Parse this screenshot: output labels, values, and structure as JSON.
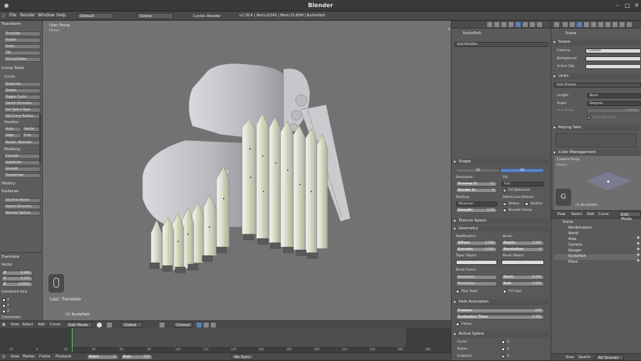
{
  "titlebar": {
    "title": "Blender"
  },
  "menubar": {
    "items": [
      "File",
      "Render",
      "Window",
      "Help"
    ],
    "screen_layout": "Default",
    "scene": "Scene",
    "engine": "Cycles Render",
    "info": "v2.78.4 | Verts:0/245 | Mem:15.80M | NurbsPath"
  },
  "toolshelf": {
    "transform_header": "Transform",
    "transform_buttons": [
      "Translate",
      "Rotate",
      "Scale",
      "Tilt",
      "Shrink/Fatten"
    ],
    "curve_tools_header": "Curve Tools",
    "curve_label": "Curve:",
    "curve_buttons": [
      "Duplicate",
      "Delete",
      "Toggle Cyclic",
      "Switch Direction",
      "Set Spline Type",
      "Set Curve Radius"
    ],
    "handles_label": "Handles:",
    "handle_buttons": [
      "Auto",
      "Vector",
      "Align",
      "Free"
    ],
    "recalc_normals": "Recalc. Normals",
    "modeling_label": "Modeling:",
    "modeling_buttons": [
      "Extrude",
      "Subdivide",
      "Smooth",
      "Randomize"
    ],
    "history_header": "History",
    "surfaces_header": "Surfaces",
    "surface_buttons": [
      "Set First Points",
      "Switch Direction",
      "Reorder Splines"
    ]
  },
  "redo_panel": {
    "header": "Translate",
    "vector_label": "Vector",
    "x": "X",
    "x_val": "0.406",
    "y": "Y",
    "y_val": "2.147",
    "z": "Z",
    "z_val": "0.0001",
    "constraint_label": "Constraint Axis",
    "axes": [
      "X",
      "Y",
      "Z"
    ],
    "orientation_label": "Orientation"
  },
  "viewport": {
    "view_name": "User Persp",
    "units": "Meters",
    "last_op": "Last: Translate",
    "object_label": "(1) NurbsPath"
  },
  "viewport_header": {
    "menus": [
      "View",
      "Select",
      "Add",
      "Curve"
    ],
    "mode": "Edit Mode",
    "orientation": "Global",
    "snap": "Closest"
  },
  "timeline": {
    "ticks": [
      "-20",
      "0",
      "20",
      "40",
      "60",
      "80",
      "100",
      "120",
      "140",
      "160",
      "180",
      "200",
      "220",
      "240",
      "260",
      "280"
    ],
    "menus": [
      "View",
      "Marker",
      "Frame",
      "Playback"
    ],
    "start_label": "Start:",
    "start_val": "1",
    "end_label": "End:",
    "end_val": "250",
    "sync": "No Sync"
  },
  "modifier_panel": {
    "object_name": "NurbsPath",
    "add_modifier": "Add Modifier",
    "shape_header": "Shape",
    "tab_2d": "2D",
    "tab_3d": "3D",
    "resolution_label": "Resolution:",
    "fill_label": "Fill:",
    "preview_u": "Preview U:",
    "preview_u_val": "12",
    "render_u": "Render U:",
    "render_u_val": "0",
    "fill_value": "Full",
    "fill_deformed": "Fill Deformed",
    "twisting_label": "Twisting:",
    "path_deform_label": "Path/Curve-Deform:",
    "twist_mode": "Minimum",
    "radius": "Radius",
    "stretch": "Stretch",
    "smooth": "Smooth:",
    "smooth_val": "0.00",
    "bounds_clamp": "Bounds Clamp",
    "texture_space_header": "Texture Space",
    "geometry_header": "Geometry",
    "modification_label": "Modification:",
    "bevel_label": "Bevel:",
    "offset": "Offset:",
    "offset_val": "0.000",
    "depth": "Depth:",
    "depth_val": "1.000",
    "extrude": "Extrude:",
    "extrude_val": "0.000",
    "resolution": "Resolution:",
    "resolution_val": "0",
    "taper_label": "Taper Object:",
    "bevel_obj_label": "Bevel Object:",
    "bevel_factor_label": "Bevel Factor:",
    "bf_res": "Resolution",
    "start": "Start:",
    "start_val": "0.000",
    "bf_res2": "Resolution",
    "end": "End:",
    "end_val": "1.000",
    "map_taper": "Map Taper",
    "fill_caps": "Fill Caps",
    "path_anim_header": "Path Animation",
    "frames": "Frames:",
    "frames_val": "100",
    "eval_time": "Evaluation Time:",
    "eval_val": "0.000",
    "follow": "Follow",
    "active_spline_header": "Active Spline",
    "cyclic": "Cyclic:",
    "bezier": "Bezier:",
    "endpoint": "Endpoint:",
    "u": "U"
  },
  "scene_panel": {
    "scene_name": "Scene",
    "scene_header": "Scene",
    "camera_label": "Camera:",
    "camera_val": "Camera",
    "background_label": "Background:",
    "active_clip_label": "Active Clip:",
    "units_header": "Units",
    "unit_presets": "Unit Presets",
    "length_label": "Length:",
    "length_val": "None",
    "angle_label": "Angle:",
    "angle_val": "Degrees",
    "unit_scale_label": "Unit Scale:",
    "unit_scale_val": "1.00000",
    "separate_units": "Separate Units",
    "keying_sets_header": "Keying Sets",
    "color_mgmt_header": "Color Management",
    "cam_view": "Camera Persp",
    "cam_units": "Meters",
    "cam_object": "(1) NurbsPath"
  },
  "outliner": {
    "menus": [
      "View",
      "Select",
      "Add",
      "Curve"
    ],
    "mode": "Edit Mode",
    "items": [
      "Scene",
      "RenderLayers",
      "World",
      "Area",
      "Camera",
      "Gauges",
      "NurbsPath",
      "Plane"
    ],
    "footer": [
      "View",
      "Search",
      "All Scenes"
    ]
  },
  "colors": {
    "background_viewport": "#727272",
    "panel_bg": "#5a5a5a",
    "curve_highlight": "#c8d05a",
    "active_tab": "#5680c2",
    "frame_marker": "#4cc24c"
  }
}
